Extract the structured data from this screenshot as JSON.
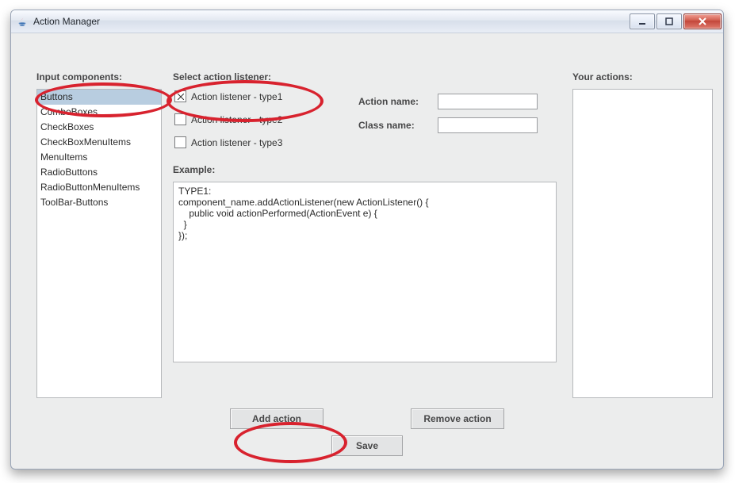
{
  "window": {
    "title": "Action Manager"
  },
  "headings": {
    "inputComponents": "Input components:",
    "selectListener": "Select action listener:",
    "example": "Example:",
    "yourActions": "Your actions:"
  },
  "inputComponents": [
    "Buttons",
    "ComboBoxes",
    "CheckBoxes",
    "CheckBoxMenuItems",
    "MenuItems",
    "RadioButtons",
    "RadioButtonMenuItems",
    "ToolBar-Buttons"
  ],
  "selectedComponentIndex": 0,
  "listeners": [
    {
      "label": "Action listener - type1",
      "checked": true
    },
    {
      "label": "Action listener - type2",
      "checked": false
    },
    {
      "label": "Action listener - type3",
      "checked": false
    }
  ],
  "fields": {
    "actionName": {
      "label": "Action name:",
      "value": ""
    },
    "className": {
      "label": "Class name:",
      "value": ""
    }
  },
  "exampleCode": "TYPE1:\ncomponent_name.addActionListener(new ActionListener() {\n    public void actionPerformed(ActionEvent e) {\n  }\n});",
  "buttons": {
    "add": "Add action",
    "remove": "Remove action",
    "save": "Save"
  }
}
